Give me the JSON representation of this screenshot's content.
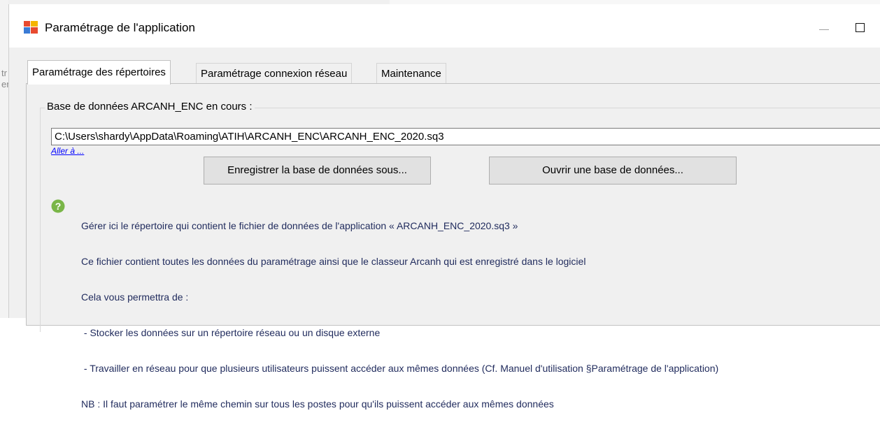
{
  "window": {
    "title": "Paramétrage de l'application",
    "background_fragments": [
      "tr",
      "er"
    ]
  },
  "tabs": [
    {
      "label": "Paramétrage des répertoires",
      "active": true
    },
    {
      "label": "Paramétrage connexion réseau",
      "active": false
    },
    {
      "label": "Maintenance",
      "active": false
    }
  ],
  "database": {
    "group_label": "Base de données ARCANH_ENC en cours :",
    "path_value": "C:\\Users\\shardy\\AppData\\Roaming\\ATIH\\ARCANH_ENC\\ARCANH_ENC_2020.sq3",
    "goto_link": "Aller à ...",
    "save_as_button": "Enregistrer la base de données sous...",
    "open_button": "Ouvrir une base de données..."
  },
  "help": {
    "icon": "question-icon",
    "lines": [
      "Gérer ici le répertoire qui contient le fichier de données de l'application « ARCANH_ENC_2020.sq3 »",
      "Ce fichier contient toutes les données du paramétrage ainsi que le classeur Arcanh qui est enregistré dans le logiciel",
      "Cela vous permettra de :",
      " - Stocker les données sur un répertoire réseau ou un disque externe",
      " - Travailler en réseau pour que plusieurs utilisateurs puissent accéder aux mêmes données (Cf. Manuel d'utilisation §Paramétrage de l'application)",
      "NB : Il faut paramétrer le même chemin sur tous les postes pour qu'ils puissent accéder aux mêmes données"
    ]
  },
  "colors": {
    "help_icon": "#7ab648",
    "link": "#0000ff",
    "help_text": "#1f2a5c",
    "client_bg": "#f0f0f0"
  }
}
